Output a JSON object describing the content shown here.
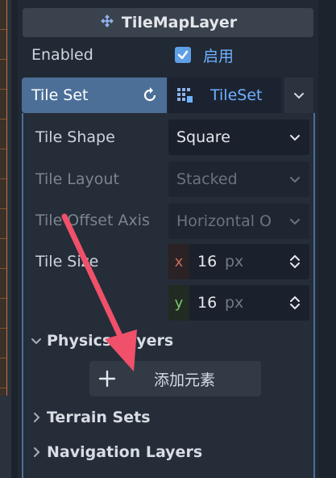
{
  "title": "TileMapLayer",
  "enabled": {
    "label": "Enabled",
    "checked": true,
    "value_text": "启用"
  },
  "tileset": {
    "tab_label": "Tile Set",
    "resource_name": "TileSet"
  },
  "properties": {
    "tile_shape": {
      "label": "Tile Shape",
      "value": "Square"
    },
    "tile_layout": {
      "label": "Tile Layout",
      "value": "Stacked"
    },
    "tile_offset_axis": {
      "label": "Tile Offset Axis",
      "value": "Horizontal O"
    },
    "tile_size": {
      "label": "Tile Size",
      "x_label": "x",
      "x": "16",
      "y_label": "y",
      "y": "16",
      "unit": "px"
    }
  },
  "sections": {
    "physics": "Physics Layers",
    "add_element": "添加元素",
    "terrain": "Terrain Sets",
    "navigation": "Navigation Layers"
  },
  "colors": {
    "accent": "#4c6f98",
    "link": "#6fb0ff",
    "annotation_arrow": "#f0506a"
  }
}
